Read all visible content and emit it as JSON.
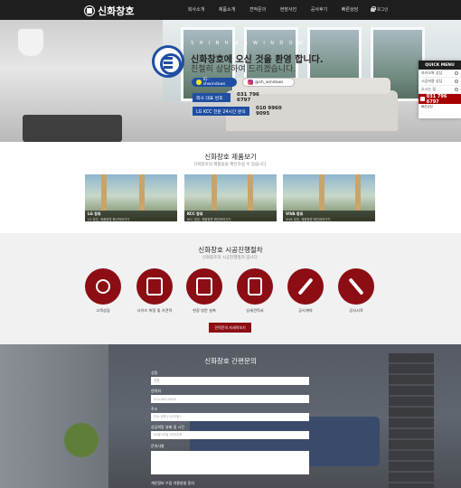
{
  "brand": {
    "name": "신화창호",
    "en": "S H I N H W A W I N D O W"
  },
  "nav": {
    "items": [
      "회사소개",
      "제품소개",
      "견적문의",
      "현장사진",
      "공사후기",
      "빠른상담"
    ],
    "login": "로그인"
  },
  "hero": {
    "welcome": "신화창호에 오신 것을 환영 합니다.",
    "welcome2": "친절히 상담하여 드리겠습니다.",
    "kakao": "ID : shwindows",
    "insta": "@sh_windows",
    "rep_label": "회사 대표 번호",
    "rep_number": "031 796 6797",
    "lg_label": "LG KCC 전문 24시간 문의",
    "lg_number": "010 9960 9095"
  },
  "quick_menu": {
    "title": "QUICK MENU",
    "items": [
      "카카오톡 상담",
      "시공비용 상담",
      "오시는 길"
    ],
    "phone": "031 796 6797",
    "phone_sub": "빠른상담"
  },
  "products": {
    "title": "신화창호 제품보기",
    "subtitle": "신화창호의 제품들을 확인하실 수 있습니다.",
    "items": [
      {
        "name": "LG 창호",
        "desc": "LG 창호, 제품종류 확인하러가기"
      },
      {
        "name": "KCC 창호",
        "desc": "KCC 창호, 제품종류 확인하러가기"
      },
      {
        "name": "VIVA 창호",
        "desc": "VIVA 창호, 제품종류 확인하러가기"
      }
    ]
  },
  "process": {
    "title": "신화창호 시공진행절차",
    "subtitle": "신화창호의 시공진행절차 입니다.",
    "steps": [
      "고객상담",
      "사이즈 측정 및 가견적",
      "현장 방문 실측",
      "상세견적서",
      "공사계약",
      "공사시작"
    ],
    "cta": "견적문의 자세히보기"
  },
  "inquiry": {
    "title": "신화창호 간편문의",
    "fields": [
      {
        "label": "성함",
        "placeholder": "성함"
      },
      {
        "label": "연락처",
        "placeholder": "010-000-0000"
      },
      {
        "label": "주소",
        "placeholder": "주소 입력 (시/구/동)"
      },
      {
        "label": "상담희망 날짜 및 시간",
        "placeholder": "00월 00일 오전/오후"
      },
      {
        "label": "문의사항",
        "placeholder": ""
      }
    ],
    "agree": "개인정보 수집 이용방침 동의"
  },
  "colors": {
    "accent": "#8c0d14",
    "brand_blue": "#1f4ea3",
    "topbar": "#1e1e1e"
  }
}
